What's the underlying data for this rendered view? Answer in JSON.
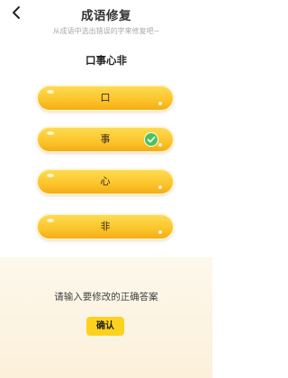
{
  "header": {
    "title": "成语修复",
    "subtitle": "从成语中选出错误的字来修复吧~"
  },
  "idiom": "口事心非",
  "options": [
    {
      "label": "口",
      "selected": false
    },
    {
      "label": "事",
      "selected": true
    },
    {
      "label": "心",
      "selected": false
    },
    {
      "label": "非",
      "selected": false
    }
  ],
  "answer": {
    "placeholder": "请输入要修改的正确答案",
    "value": ""
  },
  "confirm_label": "确认",
  "colors": {
    "option_yellow": "#fbc42a",
    "check_green": "#46c35a",
    "confirm_yellow": "#fcd21f",
    "panel_bg": "#fdf4e2"
  },
  "icons": {
    "back": "back-arrow-icon",
    "check": "check-circle-icon"
  }
}
